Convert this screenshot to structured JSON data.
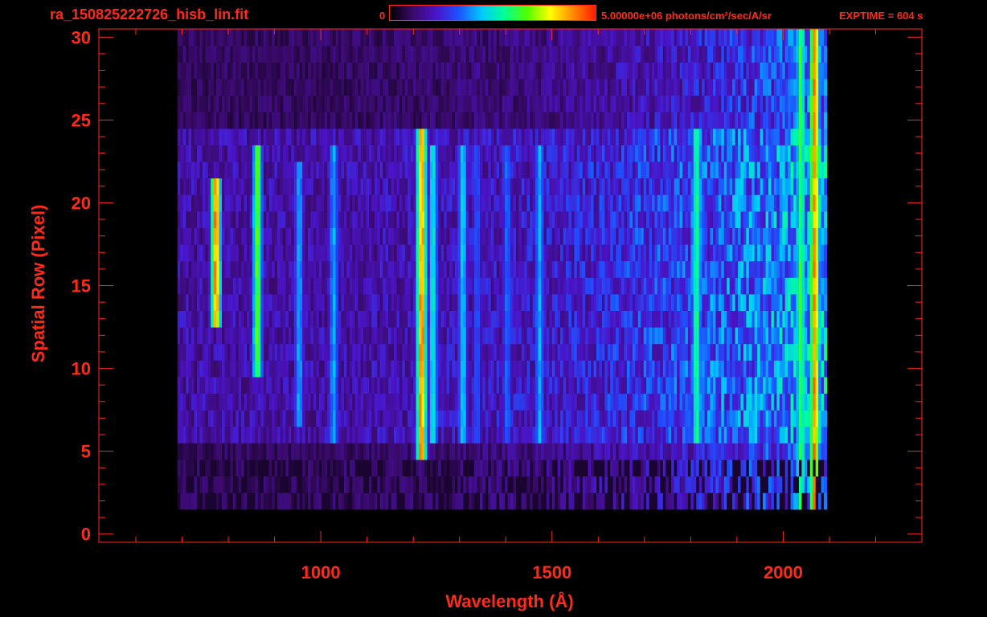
{
  "header": {
    "file_title": "ra_150825222726_hisb_lin.fit",
    "colorbar_min": "0",
    "colorbar_max": "5.00000e+06 photons/cm²/sec/A/sr",
    "exptime": "EXPTIME = 604 s"
  },
  "colors": {
    "text": "#ff2a1a",
    "background": "#000000",
    "colormap": [
      "#000000",
      "#3a0a6a",
      "#4a14c8",
      "#1e50ff",
      "#00c8ff",
      "#00ff9a",
      "#50ff00",
      "#ffff00",
      "#ff8c00",
      "#ff1a00"
    ]
  },
  "chart_data": {
    "type": "heatmap",
    "title": "ra_150825222726_hisb_lin.fit",
    "xlabel": "Wavelength (Å)",
    "ylabel": "Spatial Row (Pixel)",
    "xlim": [
      520,
      2300
    ],
    "ylim": [
      -0.5,
      30.5
    ],
    "x_ticks": [
      1000,
      1500,
      2000
    ],
    "y_ticks": [
      0,
      5,
      10,
      15,
      20,
      25,
      30
    ],
    "color_range": [
      0,
      5000000
    ],
    "color_units": "photons/cm²/sec/A/sr",
    "data_region": {
      "x": [
        690,
        2090
      ],
      "rows": [
        2,
        30
      ]
    },
    "illuminated_rows": [
      6,
      24
    ],
    "lines": [
      {
        "x": 770,
        "peak": 0.95,
        "rows": [
          13,
          21
        ]
      },
      {
        "x": 860,
        "peak": 0.7,
        "rows": [
          10,
          23
        ]
      },
      {
        "x": 950,
        "peak": 0.45,
        "rows": [
          7,
          22
        ]
      },
      {
        "x": 1025,
        "peak": 0.45,
        "rows": [
          6,
          23
        ]
      },
      {
        "x": 1215,
        "peak": 0.97,
        "rows": [
          5,
          24
        ]
      },
      {
        "x": 1240,
        "peak": 0.55,
        "rows": [
          6,
          23
        ]
      },
      {
        "x": 1304,
        "peak": 0.5,
        "rows": [
          6,
          23
        ]
      },
      {
        "x": 1335,
        "peak": 0.35,
        "rows": [
          6,
          23
        ]
      },
      {
        "x": 1400,
        "peak": 0.38,
        "rows": [
          6,
          23
        ]
      },
      {
        "x": 1470,
        "peak": 0.45,
        "rows": [
          6,
          23
        ]
      },
      {
        "x": 1810,
        "peak": 0.62,
        "rows": [
          6,
          24
        ]
      },
      {
        "x": 2035,
        "peak": 0.65,
        "rows": [
          2,
          30
        ]
      },
      {
        "x": 2065,
        "peak": 0.95,
        "rows": [
          0,
          30
        ]
      }
    ]
  }
}
